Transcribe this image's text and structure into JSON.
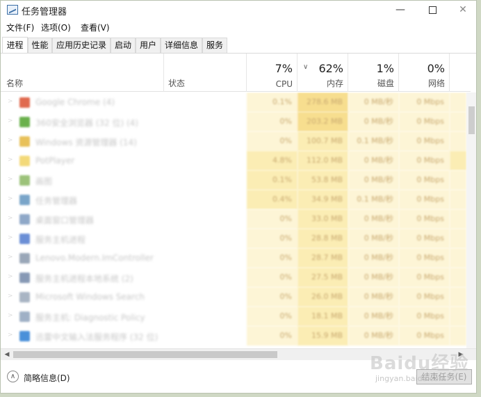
{
  "window": {
    "title": "任务管理器",
    "controls": {
      "minimize": "—",
      "close": "✕"
    }
  },
  "menu": [
    "文件(F)",
    "选项(O)",
    "查看(V)"
  ],
  "tabs": [
    "进程",
    "性能",
    "应用历史记录",
    "启动",
    "用户",
    "详细信息",
    "服务"
  ],
  "active_tab": "进程",
  "header": {
    "name": "名称",
    "status": "状态",
    "cpu": {
      "pct": "7%",
      "label": "CPU"
    },
    "memory": {
      "pct": "62%",
      "label": "内存"
    },
    "disk": {
      "pct": "1%",
      "label": "磁盘"
    },
    "network": {
      "pct": "0%",
      "label": "网络"
    },
    "overflow": "1"
  },
  "processes": [
    {
      "name": "Google Chrome (4)",
      "cpu": "0.1%",
      "mem": "278.6 MB",
      "disk": "0 MB/秒",
      "net": "0 Mbps",
      "icon_color": "#e06a4e"
    },
    {
      "name": "360安全浏览器 (32 位) (4)",
      "cpu": "0%",
      "mem": "203.2 MB",
      "disk": "0 MB/秒",
      "net": "0 Mbps",
      "icon_color": "#6ab04c"
    },
    {
      "name": "Windows 资源管理器 (14)",
      "cpu": "0%",
      "mem": "100.7 MB",
      "disk": "0.1 MB/秒",
      "net": "0 Mbps",
      "icon_color": "#e8c15a"
    },
    {
      "name": "PotPlayer",
      "cpu": "4.8%",
      "mem": "112.0 MB",
      "disk": "0 MB/秒",
      "net": "0 Mbps",
      "icon_color": "#f3d979"
    },
    {
      "name": "画图",
      "cpu": "0.1%",
      "mem": "53.8 MB",
      "disk": "0 MB/秒",
      "net": "0 Mbps",
      "icon_color": "#9cc27a"
    },
    {
      "name": "任务管理器",
      "cpu": "0.4%",
      "mem": "34.9 MB",
      "disk": "0.1 MB/秒",
      "net": "0 Mbps",
      "icon_color": "#7aa5c9"
    },
    {
      "name": "桌面窗口管理器",
      "cpu": "0%",
      "mem": "33.0 MB",
      "disk": "0 MB/秒",
      "net": "0 Mbps",
      "icon_color": "#8fa8c8"
    },
    {
      "name": "服务主机进程",
      "cpu": "0%",
      "mem": "28.8 MB",
      "disk": "0 MB/秒",
      "net": "0 Mbps",
      "icon_color": "#6b8fd6"
    },
    {
      "name": "Lenovo.Modern.ImController",
      "cpu": "0%",
      "mem": "28.7 MB",
      "disk": "0 MB/秒",
      "net": "0 Mbps",
      "icon_color": "#9aa7b8"
    },
    {
      "name": "服务主机进程本地系统 (2)",
      "cpu": "0%",
      "mem": "27.5 MB",
      "disk": "0 MB/秒",
      "net": "0 Mbps",
      "icon_color": "#8799b5"
    },
    {
      "name": "Microsoft Windows Search",
      "cpu": "0%",
      "mem": "26.0 MB",
      "disk": "0 MB/秒",
      "net": "0 Mbps",
      "icon_color": "#a9b5c4"
    },
    {
      "name": "服务主机: Diagnostic Policy",
      "cpu": "0%",
      "mem": "18.1 MB",
      "disk": "0 MB/秒",
      "net": "0 Mbps",
      "icon_color": "#9fb0c6"
    },
    {
      "name": "迅雷中文输入法服务程序 (32 位)",
      "cpu": "0%",
      "mem": "15.9 MB",
      "disk": "0 MB/秒",
      "net": "0 Mbps",
      "icon_color": "#4a90d9"
    }
  ],
  "footer": {
    "fewer_details": "简略信息(D)",
    "end_task": "结束任务(E)"
  },
  "watermark": {
    "main": "Baidu经验",
    "sub": "jingyan.baidu.com"
  },
  "colors": {
    "heat_light": "#fdf5d6",
    "heat_medium": "#fbedb4",
    "heat_strong": "#f7de8f"
  }
}
